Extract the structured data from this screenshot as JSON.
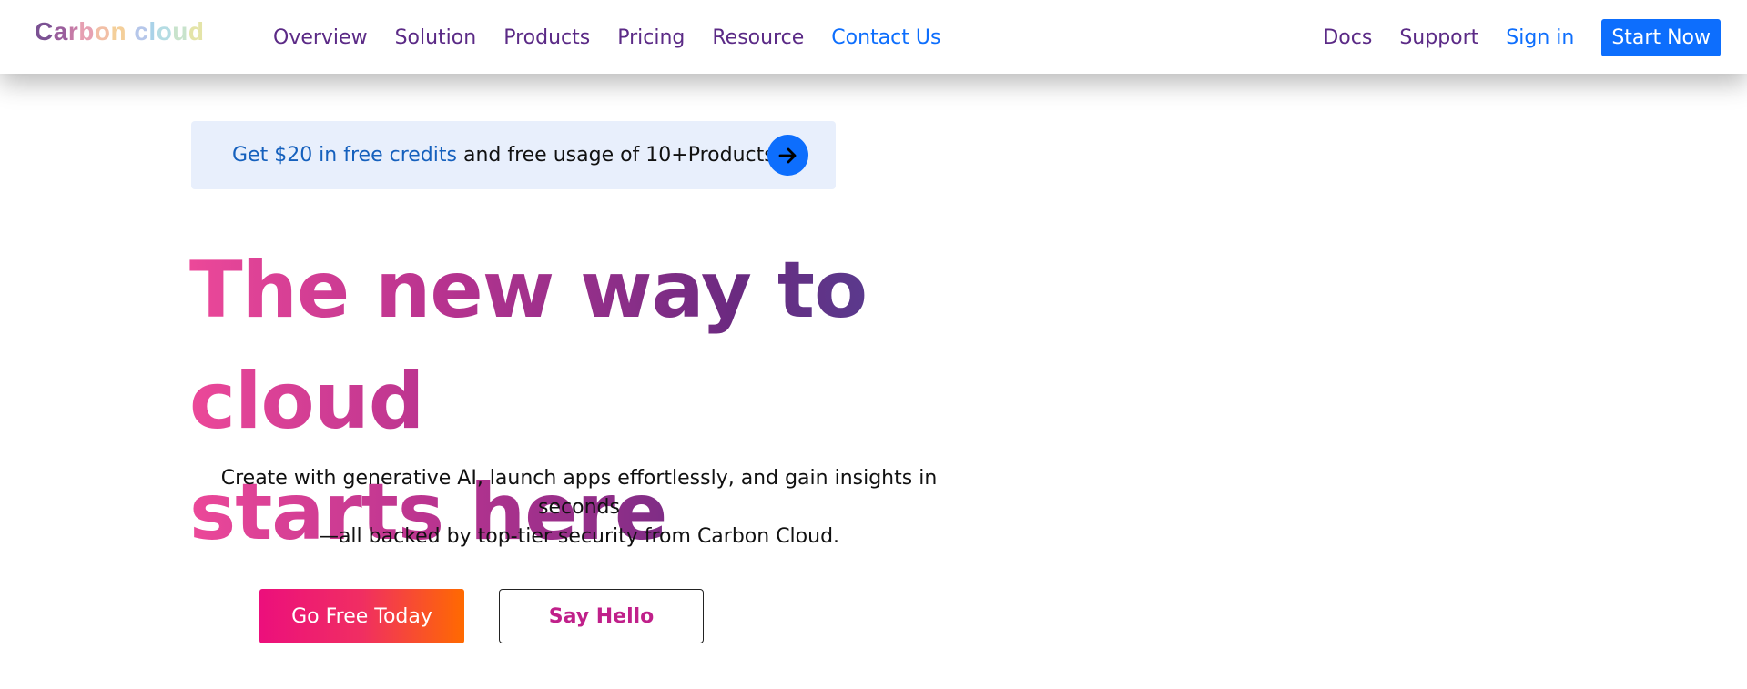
{
  "brand": {
    "logo_letters": [
      {
        "char": "C",
        "color": "#7b5193"
      },
      {
        "char": "a",
        "color": "#9a5e9c"
      },
      {
        "char": "r",
        "color": "#c57aa6"
      },
      {
        "char": "b",
        "color": "#e6a0b2"
      },
      {
        "char": "o",
        "color": "#f2bfa6"
      },
      {
        "char": "n",
        "color": "#f4cf9a"
      },
      {
        "char": " ",
        "color": "#ffffff"
      },
      {
        "char": "c",
        "color": "#b6c7ea"
      },
      {
        "char": "l",
        "color": "#a9d2e8"
      },
      {
        "char": "o",
        "color": "#b4dce3"
      },
      {
        "char": "u",
        "color": "#c8e3cc"
      },
      {
        "char": "d",
        "color": "#e4e4a8"
      }
    ]
  },
  "nav": {
    "left_items": [
      {
        "label": "Overview"
      },
      {
        "label": "Solution"
      },
      {
        "label": "Products"
      },
      {
        "label": "Pricing"
      },
      {
        "label": "Resource"
      },
      {
        "label": "Contact Us"
      }
    ],
    "right_items": [
      {
        "label": "Docs"
      },
      {
        "label": "Support"
      },
      {
        "label": "Sign in"
      }
    ],
    "cta_label": "Start Now"
  },
  "promo": {
    "link_text": "Get $20 in free credits",
    "rest_text": " and free usage of 10+Products",
    "arrow_icon": "arrow-right-icon"
  },
  "hero": {
    "title_line1": "The new way to cloud",
    "title_line2": "starts here",
    "subtitle_line1": "Create with generative AI, launch apps effortlessly, and gain insights in seconds",
    "subtitle_line2": "—all backed by top-tier security from Carbon Cloud."
  },
  "buttons": {
    "primary_label": "Go Free Today",
    "secondary_label": "Say Hello"
  },
  "colors": {
    "nav_text": "#5b2a86",
    "nav_active": "#0d6efd",
    "cta_bg": "#0d6efd",
    "promo_bg": "#e8effc",
    "primary_gradient_start": "#ec0f7c",
    "primary_gradient_end": "#ff6a00",
    "secondary_text": "#c0208a"
  }
}
